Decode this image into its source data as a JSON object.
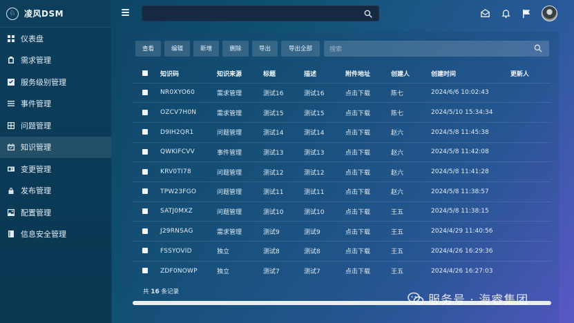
{
  "brand": {
    "name": "凌风DSM",
    "logo_glyph": "♘"
  },
  "sidebar": {
    "items": [
      {
        "label": "仪表盘",
        "icon": "dashboard-icon",
        "active": false
      },
      {
        "label": "需求管理",
        "icon": "clipboard-icon",
        "active": false
      },
      {
        "label": "服务级别管理",
        "icon": "checkbox-icon",
        "active": false
      },
      {
        "label": "事件管理",
        "icon": "list-icon",
        "active": false
      },
      {
        "label": "问题管理",
        "icon": "grid-icon",
        "active": false
      },
      {
        "label": "知识管理",
        "icon": "calendar-icon",
        "active": true
      },
      {
        "label": "变更管理",
        "icon": "id-card-icon",
        "active": false
      },
      {
        "label": "发布管理",
        "icon": "lock-icon",
        "active": false
      },
      {
        "label": "配置管理",
        "icon": "image-icon",
        "active": false
      },
      {
        "label": "信息安全管理",
        "icon": "book-icon",
        "active": false
      }
    ]
  },
  "topbar": {
    "search_value": "",
    "icons": [
      "mail-icon",
      "bell-icon",
      "flag-icon",
      "avatar"
    ]
  },
  "toolbar": {
    "view": "查看",
    "edit": "编辑",
    "add": "新增",
    "delete": "删除",
    "export": "导出",
    "export_all": "导出全部",
    "search_placeholder": "搜索"
  },
  "table": {
    "headers": [
      "知识码",
      "知识来源",
      "标题",
      "描述",
      "附件地址",
      "创建人",
      "创建时间",
      "更新人"
    ],
    "rows": [
      [
        "NR0XYO60",
        "需求管理",
        "测试16",
        "测试16",
        "点击下载",
        "陈七",
        "2024/6/6 10:02:43",
        ""
      ],
      [
        "OZCV7H0N",
        "需求管理",
        "测试15",
        "测试15",
        "点击下载",
        "陈七",
        "2024/5/10 15:34:34",
        ""
      ],
      [
        "D9IH2QR1",
        "问题管理",
        "测试14",
        "测试14",
        "点击下载",
        "赵六",
        "2024/5/8 11:45:38",
        ""
      ],
      [
        "QWKIFCVV",
        "事件管理",
        "测试13",
        "测试13",
        "点击下载",
        "赵六",
        "2024/5/8 11:42:08",
        ""
      ],
      [
        "KRV0TI78",
        "问题管理",
        "测试12",
        "测试12",
        "点击下载",
        "赵六",
        "2024/5/8 11:41:28",
        ""
      ],
      [
        "TPW23FGO",
        "问题管理",
        "测试11",
        "测试11",
        "点击下载",
        "赵六",
        "2024/5/8 11:38:57",
        ""
      ],
      [
        "SATJ0MXZ",
        "问题管理",
        "测试10",
        "测试10",
        "点击下载",
        "王五",
        "2024/5/8 11:38:15",
        ""
      ],
      [
        "J29RNSAG",
        "需求管理",
        "测试9",
        "测试9",
        "点击下载",
        "王五",
        "2024/4/29 11:40:56",
        ""
      ],
      [
        "FSSYOVID",
        "独立",
        "测试8",
        "测试8",
        "点击下载",
        "王五",
        "2024/4/26 16:29:36",
        ""
      ],
      [
        "ZDF0NOWP",
        "独立",
        "测试7",
        "测试7",
        "点击下载",
        "王五",
        "2024/4/26 16:27:03",
        ""
      ]
    ]
  },
  "footer": {
    "prefix": "共",
    "total": "16",
    "suffix": "条记录"
  },
  "watermark": {
    "text": "服务号 · 海睿集团"
  },
  "colors": {
    "accent": "#5a58c6",
    "sidebar_bg": "#0d3e5c"
  }
}
